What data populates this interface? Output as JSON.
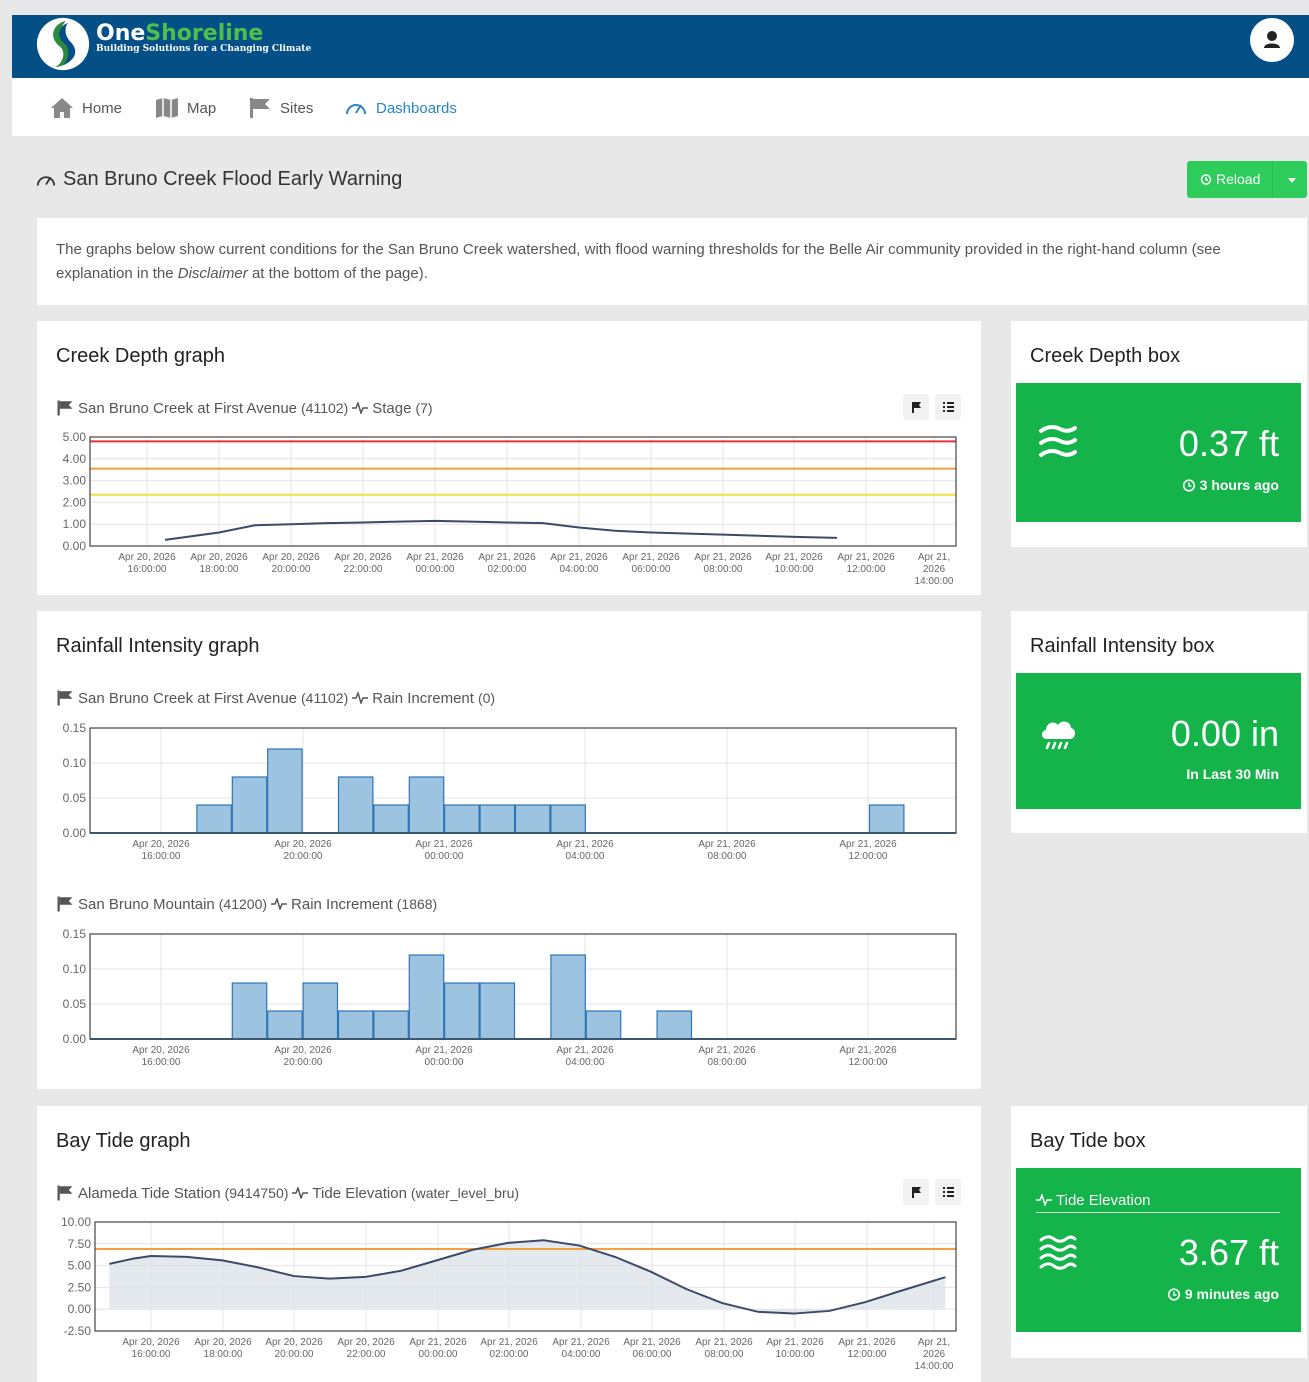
{
  "brand": {
    "name_part1": "One",
    "name_part2": "Shoreline",
    "tagline": "Building Solutions for a Changing Climate"
  },
  "nav": {
    "items": [
      {
        "label": "Home",
        "icon": "home-icon"
      },
      {
        "label": "Map",
        "icon": "map-icon"
      },
      {
        "label": "Sites",
        "icon": "flag-icon"
      },
      {
        "label": "Dashboards",
        "icon": "dashboard-icon"
      }
    ]
  },
  "page": {
    "title": "San Bruno Creek Flood Early Warning",
    "reload_label": "Reload",
    "intro_part1": "The graphs below show current conditions for the San Bruno Creek watershed, with flood warning thresholds for the Belle Air community provided in the right-hand column (see explanation in the ",
    "intro_em": "Disclaimer",
    "intro_part2": " at the bottom of the page)."
  },
  "cards": {
    "creek_graph": {
      "title": "Creek Depth graph",
      "series_station": "San Bruno Creek at First Avenue",
      "series_id": "(41102)",
      "series_param": "Stage",
      "series_code": "(7)"
    },
    "creek_box": {
      "title": "Creek Depth box",
      "value": "0.37 ft",
      "sub": "3 hours ago",
      "icon": "water-waves-icon"
    },
    "rain_graph": {
      "title": "Rainfall Intensity graph",
      "series1_station": "San Bruno Creek at First Avenue",
      "series1_id": "(41102)",
      "series1_param": "Rain Increment",
      "series1_code": "(0)",
      "series2_station": "San Bruno Mountain",
      "series2_id": "(41200)",
      "series2_param": "Rain Increment",
      "series2_code": "(1868)"
    },
    "rain_box": {
      "title": "Rainfall Intensity box",
      "value": "0.00 in",
      "sub": "In Last 30 Min",
      "icon": "cloud-rain-icon"
    },
    "tide_graph": {
      "title": "Bay Tide graph",
      "series_station": "Alameda Tide Station",
      "series_id": "(9414750)",
      "series_param": "Tide Elevation",
      "series_code": "(water_level_bru)"
    },
    "tide_box": {
      "title": "Bay Tide box",
      "header": "Tide Elevation",
      "value": "3.67 ft",
      "sub": "9 minutes ago",
      "icon": "water-waves-icon"
    }
  },
  "chart_data": [
    {
      "type": "line",
      "ylim": [
        0,
        5
      ],
      "yticks": [
        "5.00",
        "4.00",
        "3.00",
        "2.00",
        "1.00",
        "0.00"
      ],
      "xticks": [
        "Apr 20, 2026|16:00:00",
        "Apr 20, 2026|18:00:00",
        "Apr 20, 2026|20:00:00",
        "Apr 20, 2026|22:00:00",
        "Apr 21, 2026|00:00:00",
        "Apr 21, 2026|02:00:00",
        "Apr 21, 2026|04:00:00",
        "Apr 21, 2026|06:00:00",
        "Apr 21, 2026|08:00:00",
        "Apr 21, 2026|10:00:00",
        "Apr 21, 2026|12:00:00",
        "Apr 21,|2026|14:00:00"
      ],
      "thresholds": [
        {
          "value": 4.8,
          "color": "#e0303b"
        },
        {
          "value": 3.55,
          "color": "#f0a040"
        },
        {
          "value": 2.35,
          "color": "#f0e040"
        }
      ],
      "x": [
        "2026-04-20 16:30",
        "2026-04-20 18:00",
        "2026-04-20 19:00",
        "2026-04-20 20:00",
        "2026-04-20 21:00",
        "2026-04-20 22:00",
        "2026-04-20 23:00",
        "2026-04-21 00:00",
        "2026-04-21 01:00",
        "2026-04-21 02:00",
        "2026-04-21 03:00",
        "2026-04-21 04:00",
        "2026-04-21 05:00",
        "2026-04-21 06:00",
        "2026-04-21 08:00",
        "2026-04-21 10:00",
        "2026-04-21 11:10"
      ],
      "values": [
        0.28,
        0.62,
        0.95,
        1.0,
        1.05,
        1.08,
        1.12,
        1.15,
        1.12,
        1.08,
        1.05,
        0.85,
        0.7,
        0.62,
        0.52,
        0.42,
        0.37
      ]
    },
    {
      "type": "bar",
      "ylim": [
        0,
        0.15
      ],
      "yticks": [
        "0.15",
        "0.10",
        "0.05",
        "0.00"
      ],
      "xticks": [
        "Apr 20, 2026|16:00:00",
        "Apr 20, 2026|20:00:00",
        "Apr 21, 2026|00:00:00",
        "Apr 21, 2026|04:00:00",
        "Apr 21, 2026|08:00:00",
        "Apr 21, 2026|12:00:00"
      ],
      "bin_hours": 1,
      "bin_start": "2026-04-20 16:00",
      "values": [
        0,
        0.04,
        0.08,
        0.12,
        0,
        0.08,
        0.04,
        0.08,
        0.04,
        0.04,
        0.04,
        0.04,
        0,
        0,
        0,
        0,
        0,
        0,
        0,
        0,
        0.04,
        0,
        0,
        0
      ]
    },
    {
      "type": "bar",
      "ylim": [
        0,
        0.15
      ],
      "yticks": [
        "0.15",
        "0.10",
        "0.05",
        "0.00"
      ],
      "xticks": [
        "Apr 20, 2026|16:00:00",
        "Apr 20, 2026|20:00:00",
        "Apr 21, 2026|00:00:00",
        "Apr 21, 2026|04:00:00",
        "Apr 21, 2026|08:00:00",
        "Apr 21, 2026|12:00:00"
      ],
      "bin_hours": 1,
      "bin_start": "2026-04-20 16:00",
      "values": [
        0,
        0,
        0.08,
        0.04,
        0.08,
        0.04,
        0.04,
        0.12,
        0.08,
        0.08,
        0,
        0.12,
        0.04,
        0,
        0.04,
        0,
        0,
        0,
        0,
        0,
        0,
        0,
        0,
        0
      ]
    },
    {
      "type": "area",
      "ylim": [
        -2.5,
        10
      ],
      "yticks": [
        "10.00",
        "7.50",
        "5.00",
        "2.50",
        "0.00",
        "-2.50"
      ],
      "xticks": [
        "Apr 20, 2026|16:00:00",
        "Apr 20, 2026|18:00:00",
        "Apr 20, 2026|20:00:00",
        "Apr 20, 2026|22:00:00",
        "Apr 21, 2026|00:00:00",
        "Apr 21, 2026|02:00:00",
        "Apr 21, 2026|04:00:00",
        "Apr 21, 2026|06:00:00",
        "Apr 21, 2026|08:00:00",
        "Apr 21, 2026|10:00:00",
        "Apr 21, 2026|12:00:00",
        "Apr 21,|2026|14:00:00"
      ],
      "thresholds": [
        {
          "value": 6.9,
          "color": "#f0a040"
        }
      ],
      "x": [
        "2026-04-20 14:50",
        "2026-04-20 15:30",
        "2026-04-20 16:00",
        "2026-04-20 17:00",
        "2026-04-20 18:00",
        "2026-04-20 19:00",
        "2026-04-20 20:00",
        "2026-04-20 21:00",
        "2026-04-20 22:00",
        "2026-04-20 23:00",
        "2026-04-21 00:00",
        "2026-04-21 01:00",
        "2026-04-21 02:00",
        "2026-04-21 03:00",
        "2026-04-21 04:00",
        "2026-04-21 05:00",
        "2026-04-21 06:00",
        "2026-04-21 07:00",
        "2026-04-21 08:00",
        "2026-04-21 09:00",
        "2026-04-21 10:00",
        "2026-04-21 11:00",
        "2026-04-21 12:00",
        "2026-04-21 13:00",
        "2026-04-21 14:15"
      ],
      "values": [
        5.2,
        5.8,
        6.1,
        6.0,
        5.6,
        4.8,
        3.8,
        3.5,
        3.7,
        4.4,
        5.6,
        6.8,
        7.6,
        7.9,
        7.3,
        6.0,
        4.3,
        2.3,
        0.7,
        -0.3,
        -0.5,
        -0.2,
        0.8,
        2.1,
        3.67
      ]
    }
  ]
}
